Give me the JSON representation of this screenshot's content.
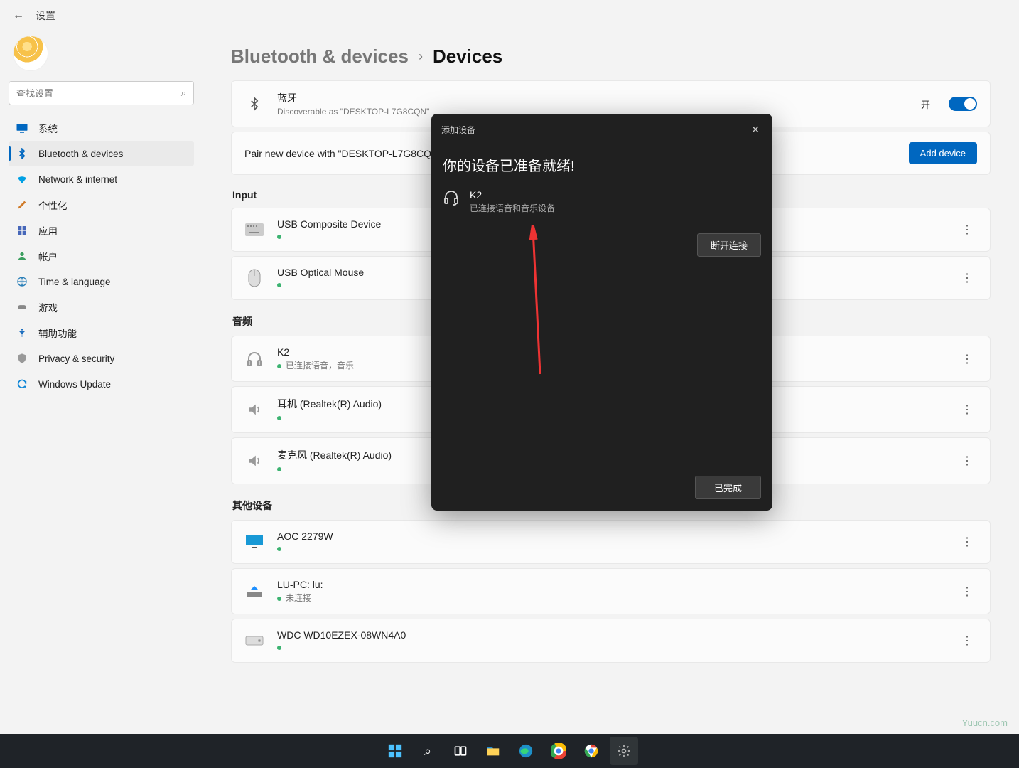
{
  "header": {
    "title": "设置"
  },
  "search": {
    "placeholder": "查找设置"
  },
  "nav": {
    "items": [
      {
        "label": "系统",
        "icon": "monitor",
        "color": "#0067c0"
      },
      {
        "label": "Bluetooth & devices",
        "icon": "bluetooth",
        "color": "#0067c0",
        "selected": true
      },
      {
        "label": "Network & internet",
        "icon": "wifi",
        "color": "#00a0e4"
      },
      {
        "label": "个性化",
        "icon": "brush",
        "color": "#d07b2a"
      },
      {
        "label": "应用",
        "icon": "apps",
        "color": "#4667b9"
      },
      {
        "label": "帐户",
        "icon": "person",
        "color": "#3b9e5f"
      },
      {
        "label": "Time & language",
        "icon": "globe",
        "color": "#2a7fb8"
      },
      {
        "label": "游戏",
        "icon": "game",
        "color": "#888"
      },
      {
        "label": "辅助功能",
        "icon": "access",
        "color": "#1e6fbf"
      },
      {
        "label": "Privacy & security",
        "icon": "shield",
        "color": "#999"
      },
      {
        "label": "Windows Update",
        "icon": "update",
        "color": "#0a84d6"
      }
    ]
  },
  "breadcrumb": {
    "level1": "Bluetooth & devices",
    "level2": "Devices"
  },
  "bluetooth_card": {
    "title": "蓝牙",
    "sub": "Discoverable as \"DESKTOP-L7G8CQN\"",
    "toggle_label": "开"
  },
  "pair_card": {
    "text": "Pair new device with \"DESKTOP-L7G8CQN\"",
    "button": "Add device"
  },
  "sections": {
    "input": {
      "heading": "Input",
      "items": [
        {
          "title": "USB Composite Device",
          "icon": "keyboard"
        },
        {
          "title": "USB Optical Mouse",
          "icon": "mouse"
        }
      ]
    },
    "audio": {
      "heading": "音频",
      "items": [
        {
          "title": "K2",
          "sub": "已连接语音，音乐",
          "icon": "headphones"
        },
        {
          "title": "耳机 (Realtek(R) Audio)",
          "icon": "speaker"
        },
        {
          "title": "麦克风 (Realtek(R) Audio)",
          "icon": "speaker"
        }
      ]
    },
    "other": {
      "heading": "其他设备",
      "items": [
        {
          "title": "AOC 2279W",
          "icon": "monitor2"
        },
        {
          "title": "LU-PC: lu:",
          "sub": "未连接",
          "icon": "pc"
        },
        {
          "title": "WDC WD10EZEX-08WN4A0",
          "icon": "disk"
        }
      ]
    }
  },
  "modal": {
    "header": "添加设备",
    "title": "你的设备已准备就绪!",
    "device_name": "K2",
    "device_status": "已连接语音和音乐设备",
    "disconnect": "断开连接",
    "done": "已完成"
  },
  "watermark": "Yuucn.com"
}
